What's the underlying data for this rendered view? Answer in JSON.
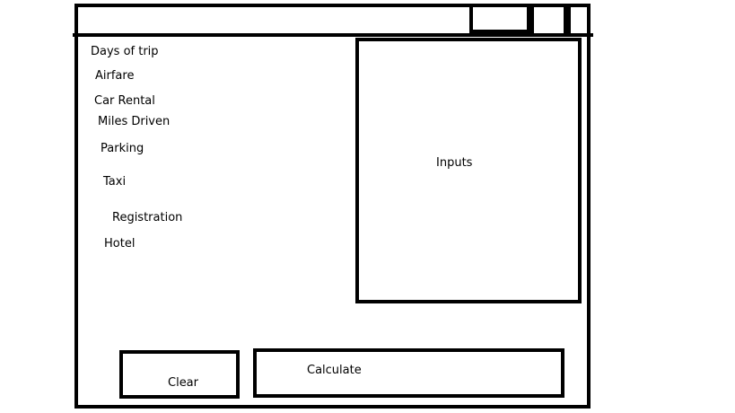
{
  "form": {
    "labels": [
      "Days of trip",
      "Airfare",
      "Car Rental",
      "Miles Driven",
      "Parking",
      "Taxi",
      "Registration",
      "Hotel"
    ]
  },
  "inputs_panel": {
    "label": "Inputs"
  },
  "buttons": {
    "clear": "Clear",
    "calculate": "Calculate"
  }
}
